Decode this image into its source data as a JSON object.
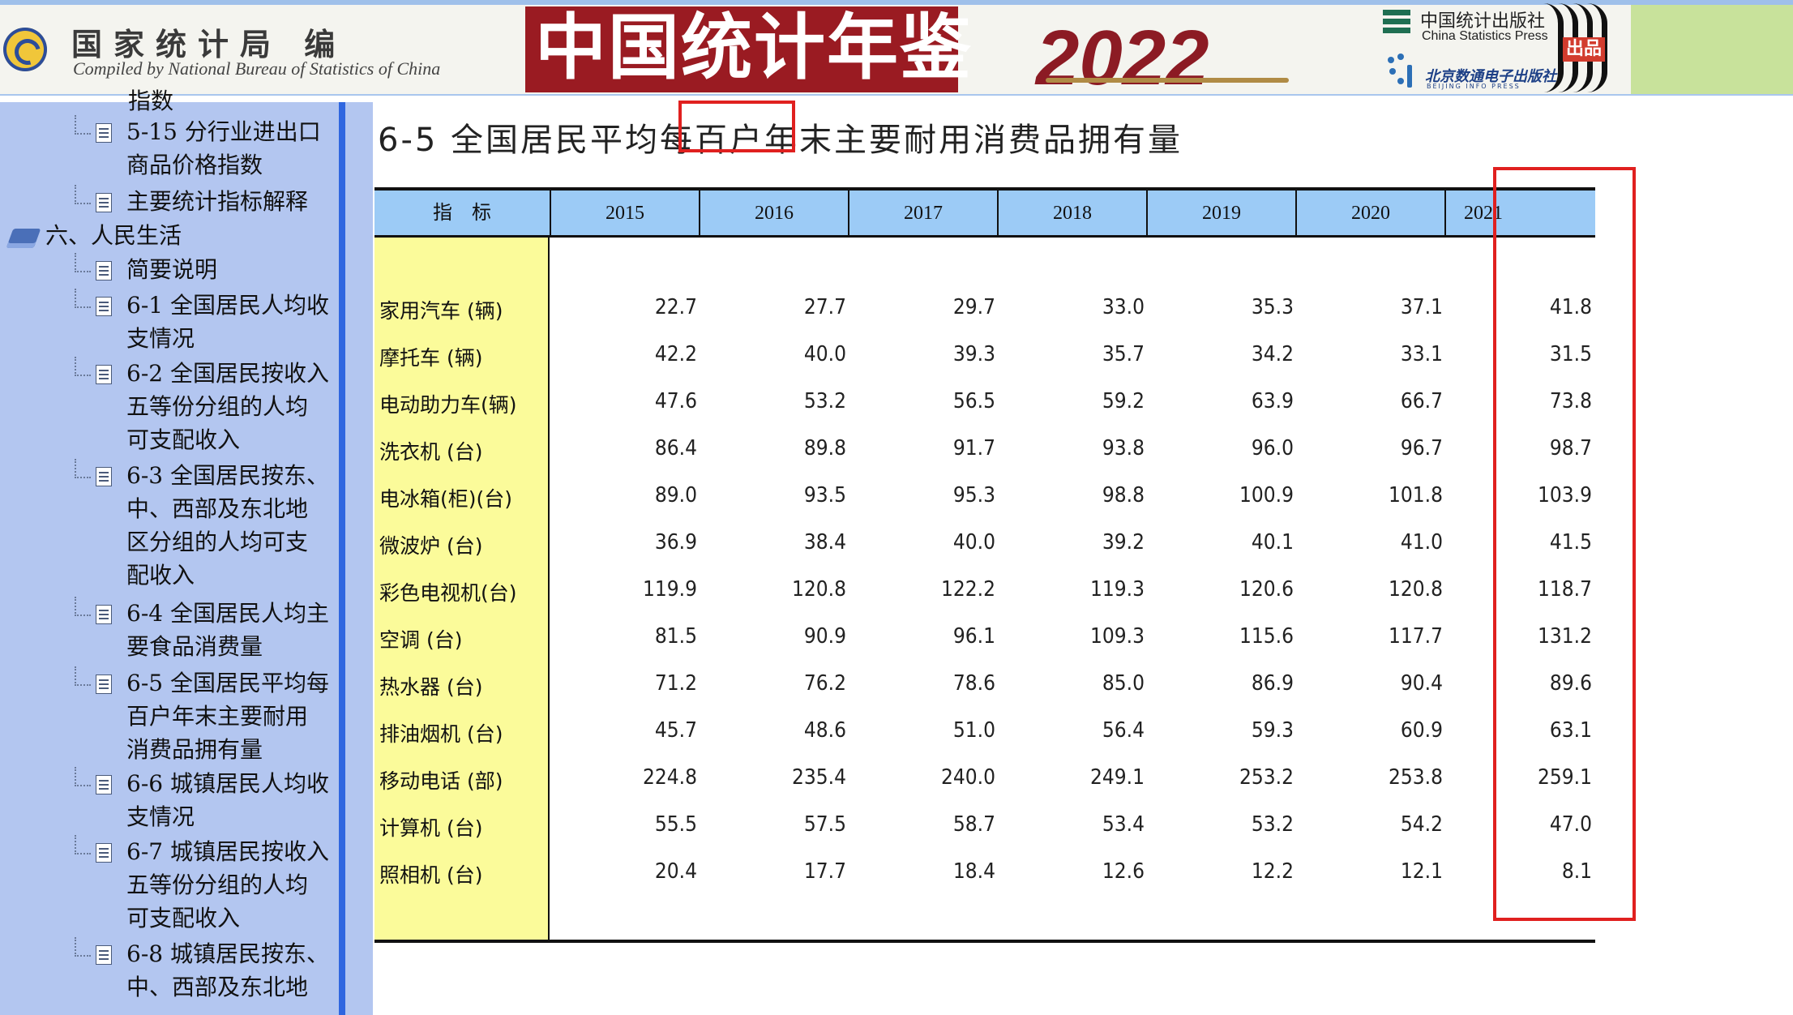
{
  "banner": {
    "compiler_cn": "国家统计局 编",
    "compiler_en": "Compiled by National Bureau of Statistics of China",
    "yearbook_title": "中国统计年鉴",
    "year": "2022",
    "press_cn": "中国统计出版社",
    "press_en": "China Statistics Press",
    "publish_badge": "出品",
    "beijing_cn": "北京数通电子出版社",
    "beijing_en": "BEIJING INFO PRESS",
    "colors": {
      "title_bg": "#9a1b22",
      "year_color": "#8c1b24"
    }
  },
  "sidebar": {
    "partial_top": "指数",
    "items": [
      {
        "label": "5-15 分行业进出口商品价格指数",
        "lines": [
          "5-15 分行业进出口",
          "商品价格指数"
        ]
      },
      {
        "label": "主要统计指标解释",
        "lines": [
          "主要统计指标解释"
        ]
      },
      {
        "label": "六、人民生活",
        "lines": [
          "六、人民生活"
        ],
        "icon": "book-icon"
      },
      {
        "label": "简要说明",
        "lines": [
          "简要说明"
        ]
      },
      {
        "label": "6-1 全国居民人均收支情况",
        "lines": [
          "6-1 全国居民人均收",
          "支情况"
        ]
      },
      {
        "label": "6-2 全国居民按收入五等份分组的人均可支配收入",
        "lines": [
          "6-2 全国居民按收入",
          "五等份分组的人均",
          "可支配收入"
        ]
      },
      {
        "label": "6-3 全国居民按东、中、西部及东北地区分组的人均可支配收入",
        "lines": [
          "6-3 全国居民按东、",
          "中、西部及东北地",
          "区分组的人均可支",
          "配收入"
        ]
      },
      {
        "label": "6-4 全国居民人均主要食品消费量",
        "lines": [
          "6-4 全国居民人均主",
          "要食品消费量"
        ]
      },
      {
        "label": "6-5 全国居民平均每百户年末主要耐用消费品拥有量",
        "lines": [
          "6-5 全国居民平均每",
          "百户年末主要耐用",
          "消费品拥有量"
        ]
      },
      {
        "label": "6-6 城镇居民人均收支情况",
        "lines": [
          "6-6 城镇居民人均收",
          "支情况"
        ]
      },
      {
        "label": "6-7 城镇居民按收入五等份分组的人均可支配收入",
        "lines": [
          "6-7 城镇居民按收入",
          "五等份分组的人均",
          "可支配收入"
        ]
      },
      {
        "label": "6-8 城镇居民按东、中、西部及东北地",
        "lines": [
          "6-8 城镇居民按东、",
          "中、西部及东北地"
        ]
      }
    ]
  },
  "page": {
    "title": "6-5 全国居民平均每百户年末主要耐用消费品拥有量",
    "highlight_color": "#e0201f"
  },
  "table": {
    "header": [
      "指　标",
      "2015",
      "2016",
      "2017",
      "2018",
      "2019",
      "2020",
      "2021"
    ],
    "rows": [
      {
        "label": "家用汽车 (辆)",
        "values": [
          "22.7",
          "27.7",
          "29.7",
          "33.0",
          "35.3",
          "37.1",
          "41.8"
        ]
      },
      {
        "label": "摩托车 (辆)",
        "values": [
          "42.2",
          "40.0",
          "39.3",
          "35.7",
          "34.2",
          "33.1",
          "31.5"
        ]
      },
      {
        "label": "电动助力车(辆)",
        "values": [
          "47.6",
          "53.2",
          "56.5",
          "59.2",
          "63.9",
          "66.7",
          "73.8"
        ]
      },
      {
        "label": "洗衣机 (台)",
        "values": [
          "86.4",
          "89.8",
          "91.7",
          "93.8",
          "96.0",
          "96.7",
          "98.7"
        ]
      },
      {
        "label": "电冰箱(柜)(台)",
        "values": [
          "89.0",
          "93.5",
          "95.3",
          "98.8",
          "100.9",
          "101.8",
          "103.9"
        ]
      },
      {
        "label": "微波炉 (台)",
        "values": [
          "36.9",
          "38.4",
          "40.0",
          "39.2",
          "40.1",
          "41.0",
          "41.5"
        ]
      },
      {
        "label": "彩色电视机(台)",
        "values": [
          "119.9",
          "120.8",
          "122.2",
          "119.3",
          "120.6",
          "120.8",
          "118.7"
        ]
      },
      {
        "label": "空调 (台)",
        "values": [
          "81.5",
          "90.9",
          "96.1",
          "109.3",
          "115.6",
          "117.7",
          "131.2"
        ]
      },
      {
        "label": "热水器 (台)",
        "values": [
          "71.2",
          "76.2",
          "78.6",
          "85.0",
          "86.9",
          "90.4",
          "89.6"
        ]
      },
      {
        "label": "排油烟机 (台)",
        "values": [
          "45.7",
          "48.6",
          "51.0",
          "56.4",
          "59.3",
          "60.9",
          "63.1"
        ]
      },
      {
        "label": "移动电话 (部)",
        "values": [
          "224.8",
          "235.4",
          "240.0",
          "249.1",
          "253.2",
          "253.8",
          "259.1"
        ]
      },
      {
        "label": "计算机 (台)",
        "values": [
          "55.5",
          "57.5",
          "58.7",
          "53.4",
          "53.2",
          "54.2",
          "47.0"
        ]
      },
      {
        "label": "照相机 (台)",
        "values": [
          "20.4",
          "17.7",
          "18.4",
          "12.6",
          "12.2",
          "12.1",
          "8.1"
        ]
      }
    ]
  }
}
